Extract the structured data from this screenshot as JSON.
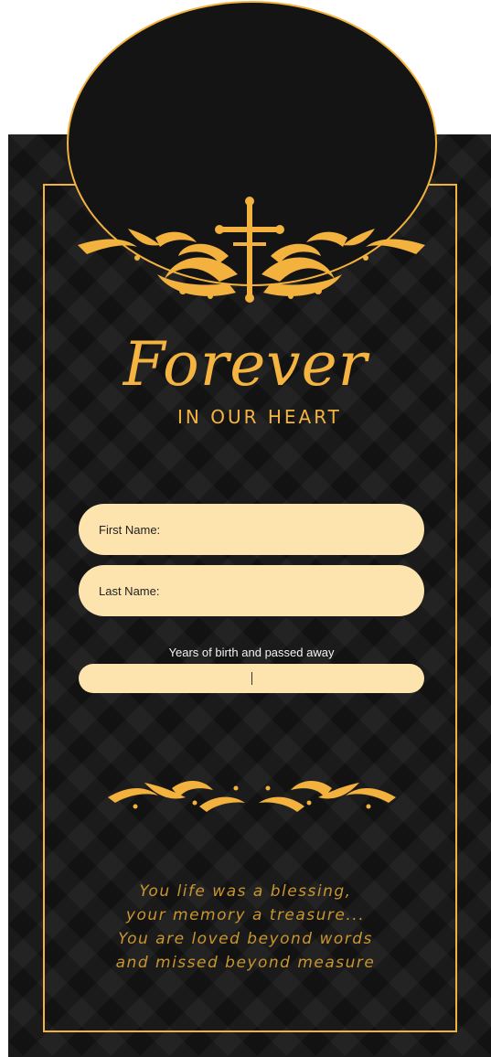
{
  "title": {
    "script": "Forever",
    "subtitle": "IN OUR HEART"
  },
  "form": {
    "first_name_label": "First Name:",
    "last_name_label": "Last Name:",
    "years_label": "Years of birth and passed away",
    "years_value": ""
  },
  "poem": {
    "lines": [
      "You life was a blessing,",
      "your memory a treasure...",
      "You are loved beyond words",
      "and missed beyond measure"
    ]
  },
  "icons": {
    "top": "cross-floral-ornament-icon",
    "divider": "floral-divider-icon"
  },
  "colors": {
    "gold": "#f3b13e",
    "background": "#1b1b1b",
    "field": "#fde3ad",
    "poem_text": "#c9952e"
  }
}
